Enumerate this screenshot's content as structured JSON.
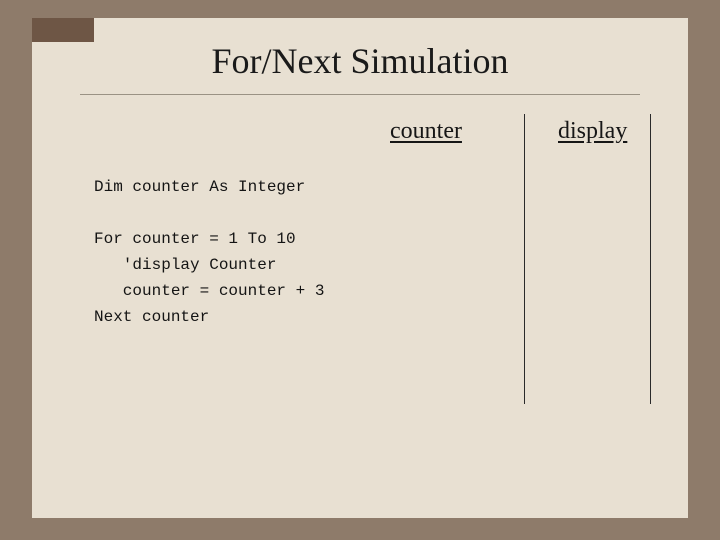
{
  "slide": {
    "title": "For/Next Simulation",
    "columns": {
      "counter_label": "counter",
      "display_label": "display"
    },
    "code": {
      "line1": "Dim counter As Integer",
      "line2": "",
      "line3": "For counter = 1 To 10",
      "line4": "   'display Counter",
      "line5": "   counter = counter + 3",
      "line6": "Next counter"
    }
  }
}
